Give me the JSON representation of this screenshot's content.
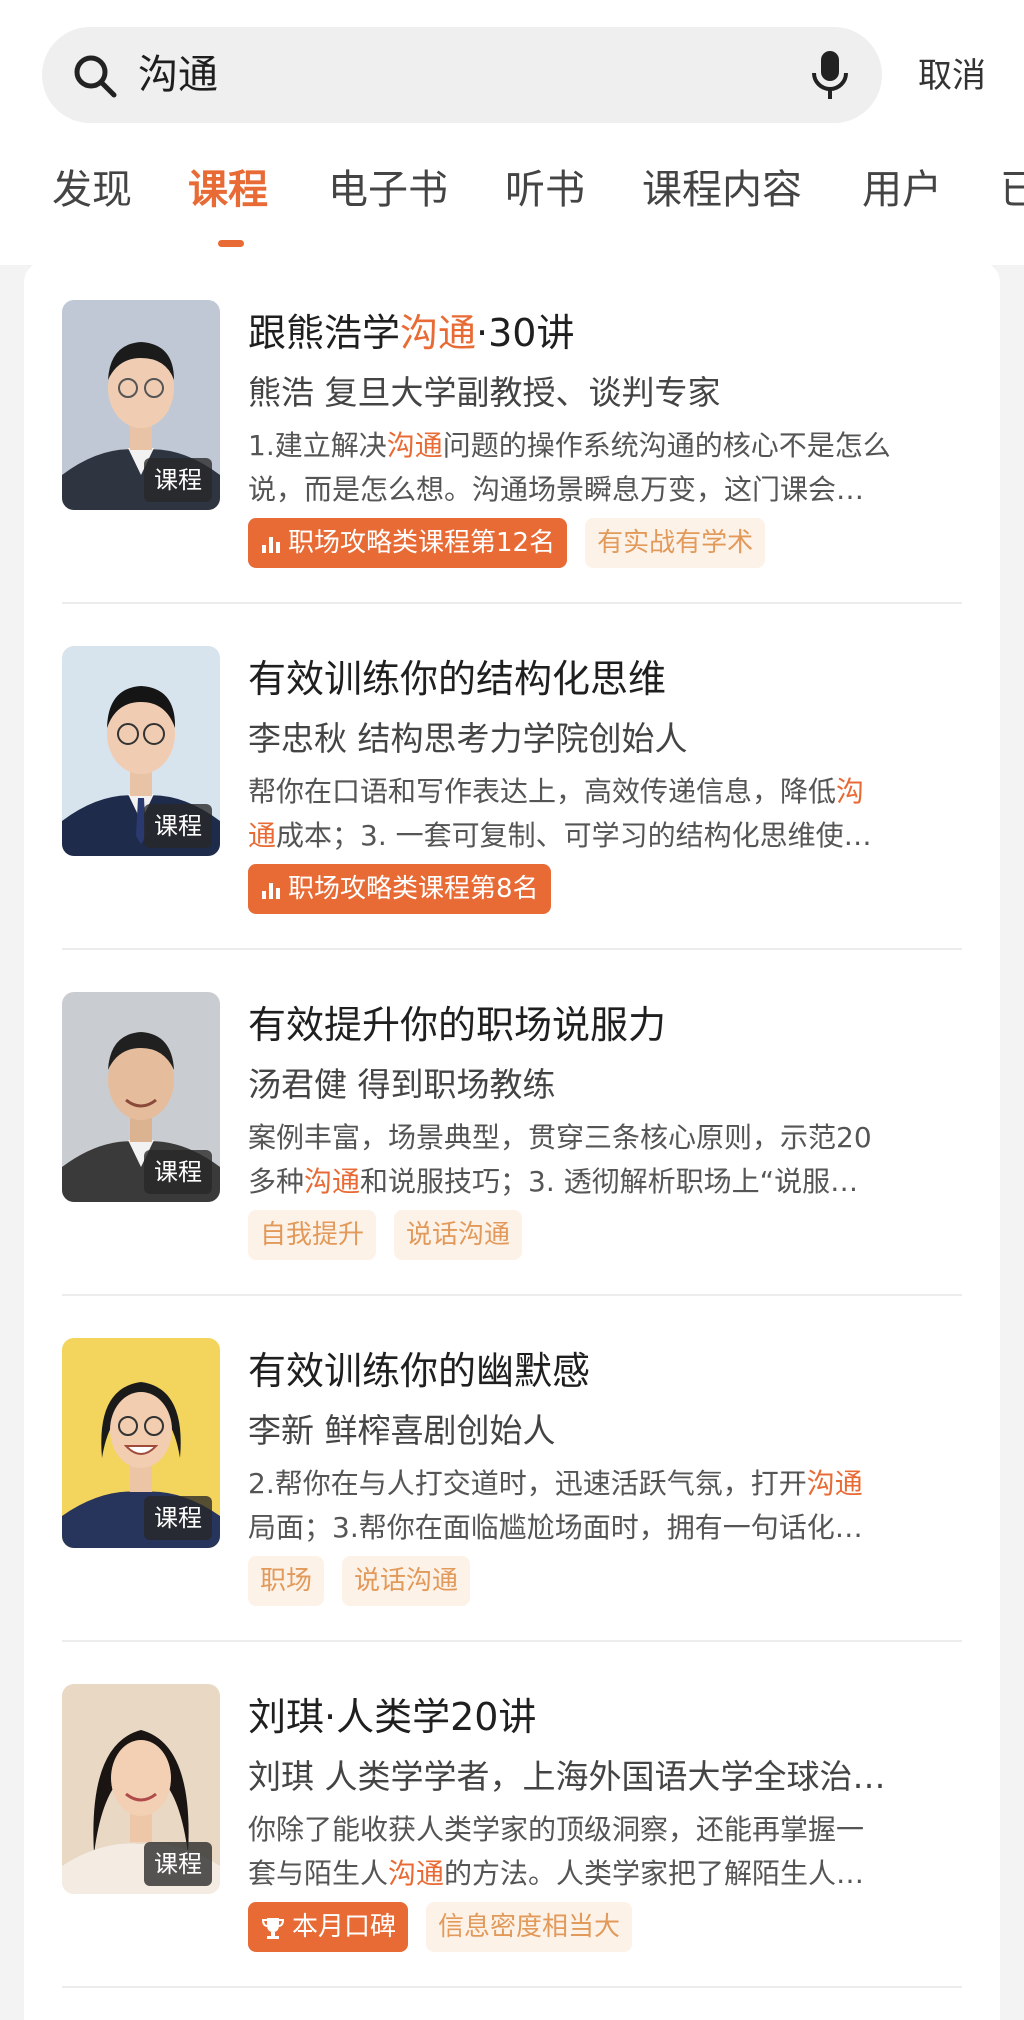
{
  "search": {
    "query": "沟通",
    "cancel_label": "取消"
  },
  "tabs": [
    {
      "label": "发现",
      "active": false
    },
    {
      "label": "课程",
      "active": true
    },
    {
      "label": "电子书",
      "active": false
    },
    {
      "label": "听书",
      "active": false
    },
    {
      "label": "课程内容",
      "active": false
    },
    {
      "label": "用户",
      "active": false
    },
    {
      "label": "已",
      "active": false
    }
  ],
  "accent_color": "#e86b35",
  "courses": [
    {
      "title": [
        "跟熊浩学",
        "沟通",
        "·30讲"
      ],
      "author": "熊浩 复旦大学副教授、谈判专家",
      "desc_line1": [
        "1.建立解决",
        "沟通",
        "问题的操作系统沟通的核心不是怎么"
      ],
      "desc_line2": [
        "说，而是怎么想。沟通场景瞬息万变，这门课会…",
        "",
        ""
      ],
      "badge": "课程",
      "tags": [
        {
          "label": "职场攻略类课程第12名",
          "kind": "rank"
        },
        {
          "label": "有实战有学术",
          "kind": "plain"
        }
      ]
    },
    {
      "title": [
        "有效训练你的结构化思维",
        "",
        ""
      ],
      "author": "李忠秋 结构思考力学院创始人",
      "desc_line1": [
        "帮你在口语和写作表达上，高效传递信息，降低",
        "沟",
        ""
      ],
      "desc_line2": [
        "",
        "通",
        "成本；3. 一套可复制、可学习的结构化思维使…"
      ],
      "badge": "课程",
      "tags": [
        {
          "label": "职场攻略类课程第8名",
          "kind": "rank"
        }
      ]
    },
    {
      "title": [
        "有效提升你的职场说服力",
        "",
        ""
      ],
      "author": "汤君健 得到职场教练",
      "desc_line1": [
        "案例丰富，场景典型，贯穿三条核心原则，示范20",
        "",
        ""
      ],
      "desc_line2": [
        "多种",
        "沟通",
        "和说服技巧；3. 透彻解析职场上“说服…"
      ],
      "badge": "课程",
      "tags": [
        {
          "label": "自我提升",
          "kind": "plain"
        },
        {
          "label": "说话沟通",
          "kind": "plain"
        }
      ]
    },
    {
      "title": [
        "有效训练你的幽默感",
        "",
        ""
      ],
      "author": "李新 鲜榨喜剧创始人",
      "desc_line1": [
        "2.帮你在与人打交道时，迅速活跃气氛，打开",
        "沟通",
        ""
      ],
      "desc_line2": [
        "局面；3.帮你在面临尴尬场面时，拥有一句话化…",
        "",
        ""
      ],
      "badge": "课程",
      "tags": [
        {
          "label": "职场",
          "kind": "plain"
        },
        {
          "label": "说话沟通",
          "kind": "plain"
        }
      ]
    },
    {
      "title": [
        "刘琪·人类学20讲",
        "",
        ""
      ],
      "author": "刘琪 人类学学者，上海外国语大学全球治…",
      "desc_line1": [
        "你除了能收获人类学家的顶级洞察，还能再掌握一",
        "",
        ""
      ],
      "desc_line2": [
        "套与陌生人",
        "沟通",
        "的方法。人类学家把了解陌生人…"
      ],
      "badge": "课程",
      "tags": [
        {
          "label": "本月口碑",
          "kind": "rank-trophy"
        },
        {
          "label": "信息密度相当大",
          "kind": "plain"
        }
      ]
    }
  ]
}
